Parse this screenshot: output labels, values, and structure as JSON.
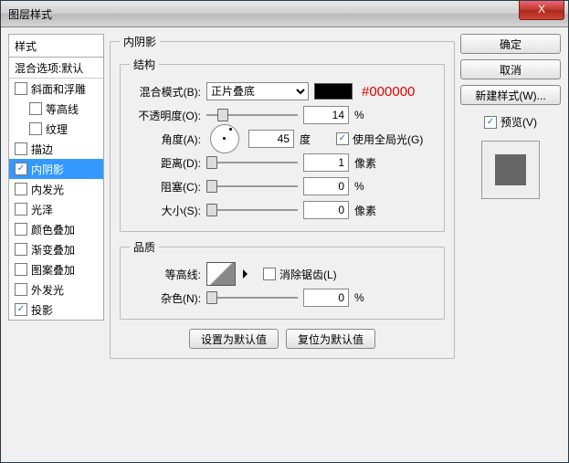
{
  "window": {
    "title": "图层样式"
  },
  "close": "X",
  "styles": {
    "header": "样式",
    "blend_defaults": "混合选项:默认",
    "items": [
      {
        "label": "斜面和浮雕",
        "checked": false,
        "indent": false
      },
      {
        "label": "等高线",
        "checked": false,
        "indent": true
      },
      {
        "label": "纹理",
        "checked": false,
        "indent": true
      },
      {
        "label": "描边",
        "checked": false,
        "indent": false
      },
      {
        "label": "内阴影",
        "checked": true,
        "indent": false,
        "selected": true
      },
      {
        "label": "内发光",
        "checked": false,
        "indent": false
      },
      {
        "label": "光泽",
        "checked": false,
        "indent": false
      },
      {
        "label": "颜色叠加",
        "checked": false,
        "indent": false
      },
      {
        "label": "渐变叠加",
        "checked": false,
        "indent": false
      },
      {
        "label": "图案叠加",
        "checked": false,
        "indent": false
      },
      {
        "label": "外发光",
        "checked": false,
        "indent": false
      },
      {
        "label": "投影",
        "checked": true,
        "indent": false
      }
    ]
  },
  "panel": {
    "title": "内阴影",
    "structure": {
      "legend": "结构",
      "blend_mode_label": "混合模式(B):",
      "blend_mode_value": "正片叠底",
      "color_hex": "#000000",
      "opacity_label": "不透明度(O):",
      "opacity_value": "14",
      "opacity_unit": "%",
      "angle_label": "角度(A):",
      "angle_value": "45",
      "angle_unit": "度",
      "global_light_label": "使用全局光(G)",
      "global_light_checked": true,
      "distance_label": "距离(D):",
      "distance_value": "1",
      "distance_unit": "像素",
      "choke_label": "阻塞(C):",
      "choke_value": "0",
      "choke_unit": "%",
      "size_label": "大小(S):",
      "size_value": "0",
      "size_unit": "像素"
    },
    "quality": {
      "legend": "品质",
      "contour_label": "等高线:",
      "antialias_label": "消除锯齿(L)",
      "antialias_checked": false,
      "noise_label": "杂色(N):",
      "noise_value": "0",
      "noise_unit": "%"
    },
    "buttons": {
      "set_default": "设置为默认值",
      "reset_default": "复位为默认值"
    }
  },
  "right": {
    "ok": "确定",
    "cancel": "取消",
    "new_style": "新建样式(W)...",
    "preview_label": "预览(V)",
    "preview_checked": true
  }
}
